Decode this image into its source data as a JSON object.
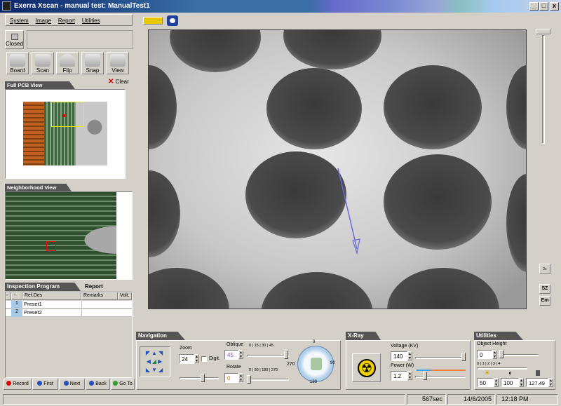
{
  "window": {
    "title": "Exerra Xscan - manual test: ManualTest1",
    "minimize": "_",
    "maximize": "□",
    "close": "x"
  },
  "menu": [
    "System",
    "Image",
    "Report",
    "Utilities"
  ],
  "closed_label": "Closed",
  "toolbar": [
    "Board",
    "Scan",
    "Flip",
    "Snap",
    "View"
  ],
  "clear_label": "Clear",
  "full_pcb_view": "Full PCB View",
  "neighborhood_view": "Neighborhood View",
  "inspection": {
    "tab_program": "Inspection Program",
    "tab_report": "Report",
    "columns": [
      "-",
      "-",
      "Ref.Des",
      "Remarks",
      "Volt."
    ],
    "rows": [
      {
        "num": "1",
        "ref": "Preset1"
      },
      {
        "num": "2",
        "ref": "Preset2"
      }
    ]
  },
  "nav_buttons": [
    "Record",
    "First",
    "Next",
    "Back",
    "Go To"
  ],
  "navigation": {
    "header": "Navigation",
    "zoom_label": "Zoom",
    "zoom_value": "24",
    "digit_label": "Digit.",
    "oblique_label": "Oblique",
    "oblique_value": "45",
    "oblique_scale": [
      "0",
      "15",
      "30",
      "45"
    ],
    "oblique_max": "270",
    "rotate_label": "Rotate",
    "rotate_value": "0",
    "rotate_scale": [
      "0",
      "90",
      "180",
      "270"
    ],
    "dial_top": "0",
    "dial_right": "90",
    "dial_bottom": "180"
  },
  "xray": {
    "header": "X-Ray",
    "voltage_label": "Voltage (KV)",
    "voltage_value": "140",
    "power_label": "Power (W)",
    "power_value": "1.2"
  },
  "utilities": {
    "header": "Utilities",
    "object_height_label": "Object Height",
    "height_value": "0",
    "height_scale": [
      "0",
      "1",
      "2",
      "3",
      "4"
    ],
    "brightness": "50",
    "contrast": "100",
    "value3": "127.49"
  },
  "right_side": {
    "zoom_btn": "2x",
    "btn_sz": "SZ",
    "btn_em": "Em"
  },
  "status": {
    "elapsed": "567sec",
    "date": "14/6/2005",
    "time": "12:18 PM"
  },
  "colors": {
    "title_start": "#0a246a",
    "panel_header": "#555555",
    "accent_yellow": "#e8c800"
  }
}
